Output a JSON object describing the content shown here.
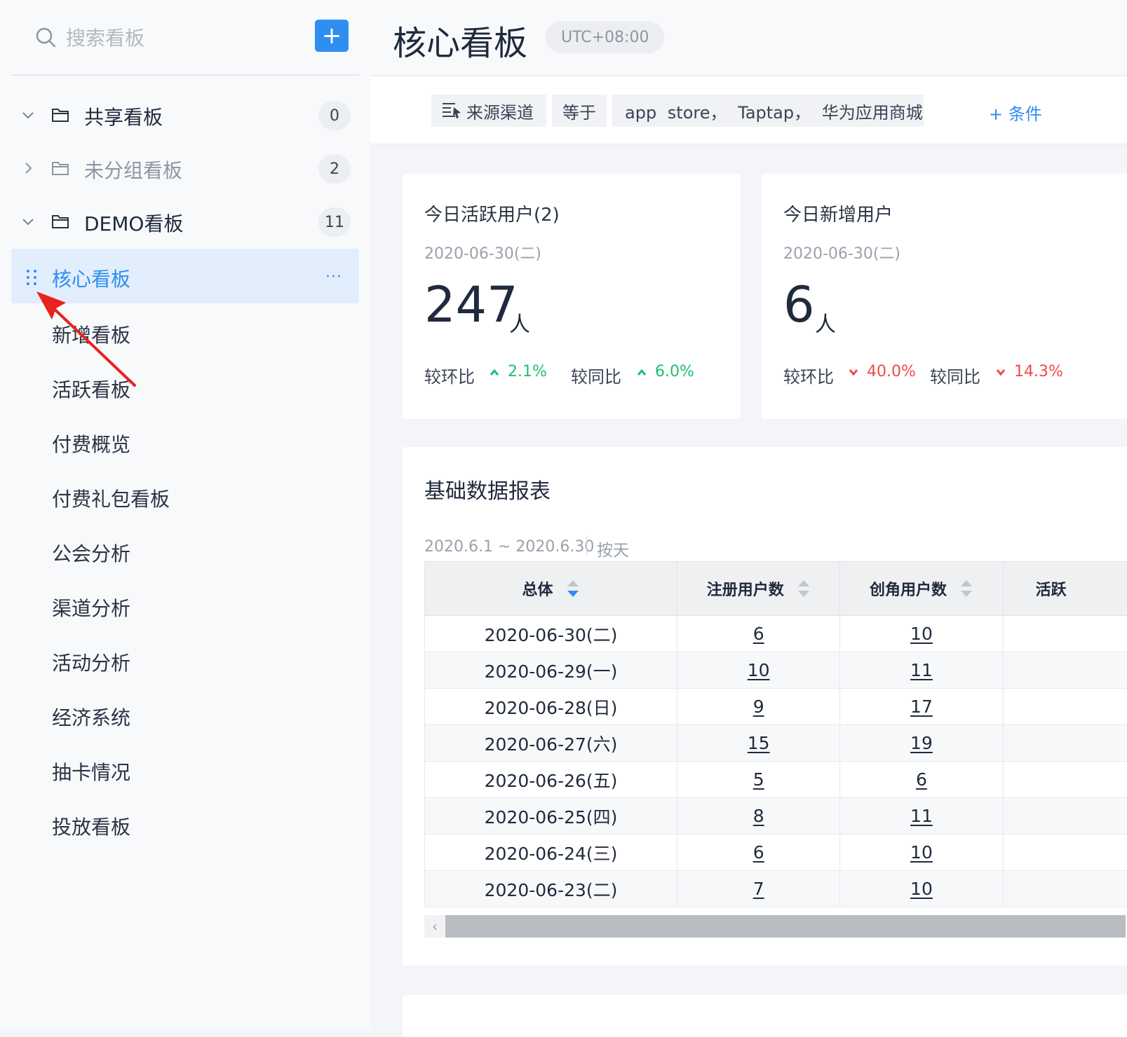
{
  "sidebar": {
    "search_placeholder": "搜索看板",
    "add_label": "+",
    "groups": [
      {
        "label": "共享看板",
        "count": "0"
      },
      {
        "label": "未分组看板",
        "count": "2"
      },
      {
        "label": "DEMO看板",
        "count": "11"
      }
    ],
    "active_item": {
      "label": "核心看板",
      "more": "···"
    },
    "items": [
      "新增看板",
      "活跃看板",
      "付费概览",
      "付费礼包看板",
      "公会分析",
      "渠道分析",
      "活动分析",
      "经济系统",
      "抽卡情况",
      "投放看板"
    ]
  },
  "header": {
    "title": "核心看板",
    "timezone": "UTC+08:00"
  },
  "filter": {
    "field": "来源渠道",
    "operator": "等于",
    "values": "app store， Taptap， 华为应用商城",
    "add_condition": "+ 条件"
  },
  "metrics": [
    {
      "title": "今日活跃用户(2)",
      "date": "2020-06-30(二)",
      "value": "247",
      "unit": "人",
      "mom_label": "较环比",
      "mom_value": "2.1%",
      "yoy_label": "较同比",
      "yoy_value": "6.0%"
    },
    {
      "title": "今日新增用户",
      "date": "2020-06-30(二)",
      "value": "6",
      "unit": "人",
      "mom_label": "较环比",
      "mom_value": "40.0%",
      "yoy_label": "较同比",
      "yoy_value": "14.3%"
    }
  ],
  "colors": {
    "accent": "#2f8ef0",
    "up": "#1dbf73",
    "down": "#f04a4a"
  },
  "table": {
    "title": "基础数据报表",
    "range": "2020.6.1 ~ 2020.6.30",
    "granularity": "按天",
    "headers": [
      "总体",
      "注册用户数",
      "创角用户数",
      "活跃"
    ],
    "rows": [
      {
        "date": "2020-06-30(二)",
        "reg": "6",
        "role": "10"
      },
      {
        "date": "2020-06-29(一)",
        "reg": "10",
        "role": "11"
      },
      {
        "date": "2020-06-28(日)",
        "reg": "9",
        "role": "17"
      },
      {
        "date": "2020-06-27(六)",
        "reg": "15",
        "role": "19"
      },
      {
        "date": "2020-06-26(五)",
        "reg": "5",
        "role": "6"
      },
      {
        "date": "2020-06-25(四)",
        "reg": "8",
        "role": "11"
      },
      {
        "date": "2020-06-24(三)",
        "reg": "6",
        "role": "10"
      },
      {
        "date": "2020-06-23(二)",
        "reg": "7",
        "role": "10"
      }
    ],
    "scroll_left": "‹"
  }
}
